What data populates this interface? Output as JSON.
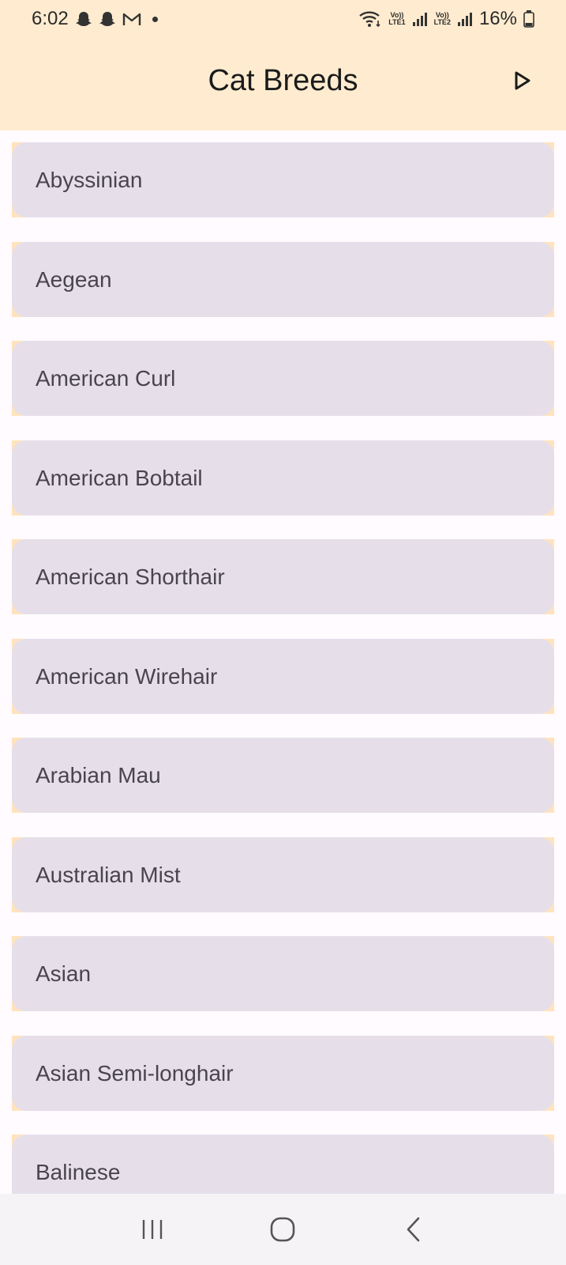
{
  "status_bar": {
    "time": "6:02",
    "battery": "16%",
    "sim1_label": "LTE1",
    "sim2_label": "LTE2",
    "volte_label": "Vo))",
    "icons": [
      "snapchat-icon",
      "snapchat-icon",
      "gmail-icon",
      "notification-dot",
      "wifi-icon",
      "signal-icon",
      "signal-icon",
      "battery-icon"
    ]
  },
  "app_bar": {
    "title": "Cat Breeds",
    "action_icon": "play-icon"
  },
  "breeds": [
    "Abyssinian",
    "Aegean",
    "American Curl",
    "American Bobtail",
    "American Shorthair",
    "American Wirehair",
    "Arabian Mau",
    "Australian Mist",
    "Asian",
    "Asian Semi-longhair",
    "Balinese"
  ],
  "nav_bar": {
    "icons": [
      "recents-icon",
      "home-icon",
      "back-icon"
    ]
  },
  "colors": {
    "app_bar_bg": "#ffecd0",
    "card_bg": "#e6dfea",
    "card_text": "#49454f",
    "page_bg": "#fffbfe"
  }
}
